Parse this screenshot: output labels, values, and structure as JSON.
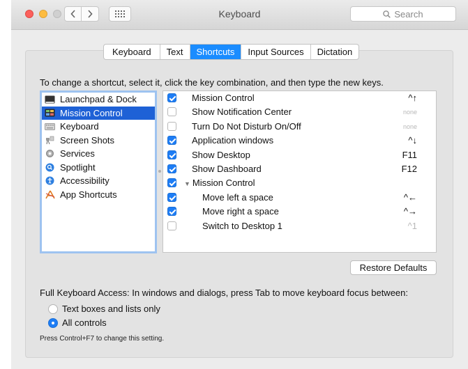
{
  "window": {
    "title": "Keyboard"
  },
  "search": {
    "placeholder": "Search"
  },
  "tabs": [
    {
      "label": "Keyboard",
      "active": false
    },
    {
      "label": "Text",
      "active": false
    },
    {
      "label": "Shortcuts",
      "active": true
    },
    {
      "label": "Input Sources",
      "active": false
    },
    {
      "label": "Dictation",
      "active": false
    }
  ],
  "instructions": "To change a shortcut, select it, click the key combination, and then type the new keys.",
  "categories": [
    {
      "label": "Launchpad & Dock",
      "icon": "launchpad-dock-icon"
    },
    {
      "label": "Mission Control",
      "icon": "mission-control-icon",
      "selected": true
    },
    {
      "label": "Keyboard",
      "icon": "keyboard-icon"
    },
    {
      "label": "Screen Shots",
      "icon": "screenshot-icon"
    },
    {
      "label": "Services",
      "icon": "gear-icon"
    },
    {
      "label": "Spotlight",
      "icon": "spotlight-icon"
    },
    {
      "label": "Accessibility",
      "icon": "accessibility-icon"
    },
    {
      "label": "App Shortcuts",
      "icon": "app-shortcuts-icon"
    }
  ],
  "shortcuts": [
    {
      "label": "Mission Control",
      "key": "^↑",
      "checked": true
    },
    {
      "label": "Show Notification Center",
      "key": "none",
      "checked": false
    },
    {
      "label": "Turn Do Not Disturb On/Off",
      "key": "none",
      "checked": false
    },
    {
      "label": "Application windows",
      "key": "^↓",
      "checked": true
    },
    {
      "label": "Show Desktop",
      "key": "F11",
      "checked": true
    },
    {
      "label": "Show Dashboard",
      "key": "F12",
      "checked": true
    },
    {
      "label": "Mission Control",
      "key": "",
      "checked": true,
      "group": true
    },
    {
      "label": "Move left a space",
      "key": "^←",
      "checked": true
    },
    {
      "label": "Move right a space",
      "key": "^→",
      "checked": true
    },
    {
      "label": "Switch to Desktop 1",
      "key": "^1",
      "checked": false
    }
  ],
  "restore_label": "Restore Defaults",
  "full_keyboard_access": "Full Keyboard Access: In windows and dialogs, press Tab to move keyboard focus between:",
  "radio_options": [
    {
      "label": "Text boxes and lists only",
      "selected": false
    },
    {
      "label": "All controls",
      "selected": true
    }
  ],
  "note": "Press Control+F7 to change this setting.",
  "colors": {
    "accent": "#1a8cff",
    "selection": "#1e61d6"
  }
}
